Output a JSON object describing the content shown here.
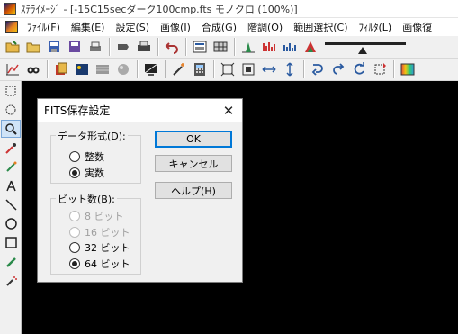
{
  "window": {
    "title": "ｽﾃﾗｲﾒｰｼﾞ - [-15C15secダーク100cmp.fts モノクロ (100%)]"
  },
  "menu": [
    "ﾌｧｲﾙ(F)",
    "編集(E)",
    "設定(S)",
    "画像(I)",
    "合成(G)",
    "階調(O)",
    "範囲選択(C)",
    "ﾌｨﾙﾀ(L)",
    "画像復"
  ],
  "dialog": {
    "title": "FITS保存設定",
    "close_icon": "close-icon",
    "data_format": {
      "label": "データ形式(D):",
      "options": [
        "整数",
        "実数"
      ],
      "selected": "実数"
    },
    "bit_depth": {
      "label": "ビット数(B):",
      "options": [
        "8 ビット",
        "16 ビット",
        "32 ビット",
        "64 ビット"
      ],
      "disabled": [
        "8 ビット",
        "16 ビット"
      ],
      "selected": "64 ビット"
    },
    "buttons": {
      "ok": "OK",
      "cancel": "キャンセル",
      "help": "ヘルプ(H)"
    }
  },
  "colors": {
    "canvas": "#000000",
    "chrome": "#f0f0f0",
    "accent": "#0078d7"
  }
}
